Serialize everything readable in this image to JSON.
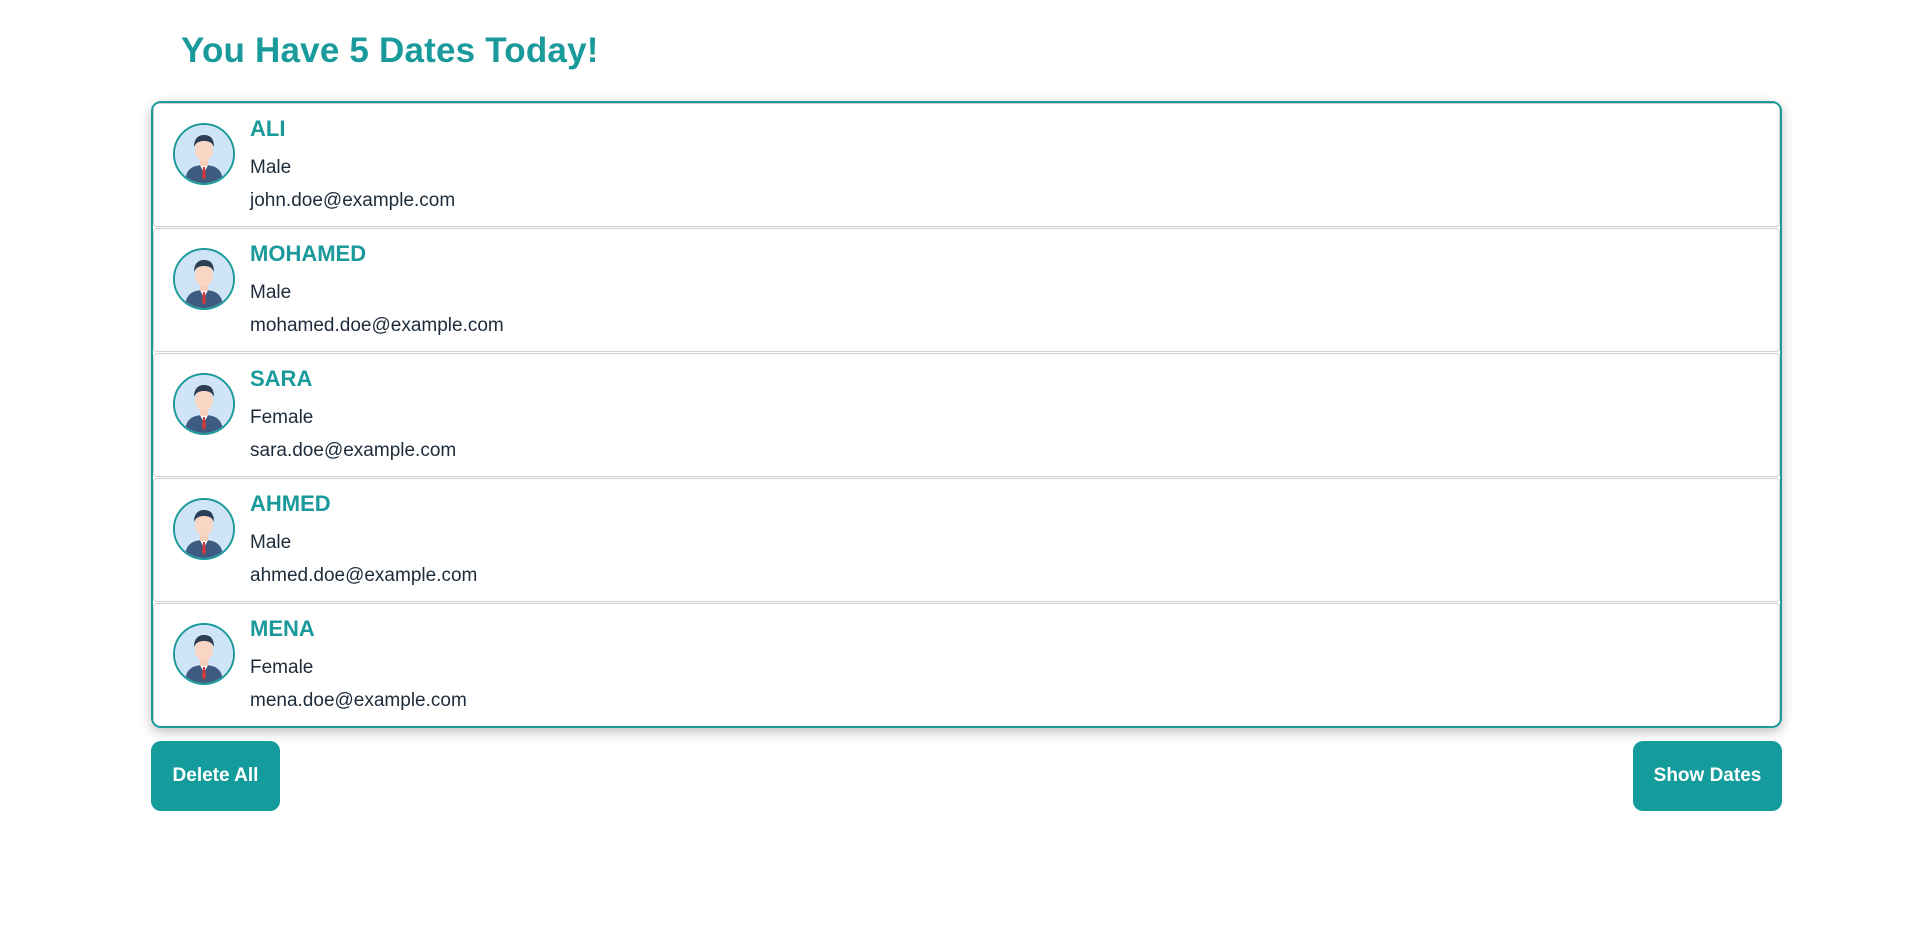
{
  "header": {
    "title": "You Have 5 Dates Today!"
  },
  "people": [
    {
      "name": "ALI",
      "gender": "Male",
      "email": "john.doe@example.com",
      "icon": "male-avatar-icon"
    },
    {
      "name": "MOHAMED",
      "gender": "Male",
      "email": "mohamed.doe@example.com",
      "icon": "male-avatar-icon"
    },
    {
      "name": "SARA",
      "gender": "Female",
      "email": "sara.doe@example.com",
      "icon": "male-avatar-icon"
    },
    {
      "name": "AHMED",
      "gender": "Male",
      "email": "ahmed.doe@example.com",
      "icon": "male-avatar-icon"
    },
    {
      "name": "MENA",
      "gender": "Female",
      "email": "mena.doe@example.com",
      "icon": "male-avatar-icon"
    }
  ],
  "actions": {
    "delete_all_label": "Delete All",
    "show_dates_label": "Show Dates"
  },
  "colors": {
    "accent": "#1a9a9a",
    "button_bg": "#149b9b",
    "text": "#1d2b3a",
    "divider": "#cfcfcf"
  }
}
